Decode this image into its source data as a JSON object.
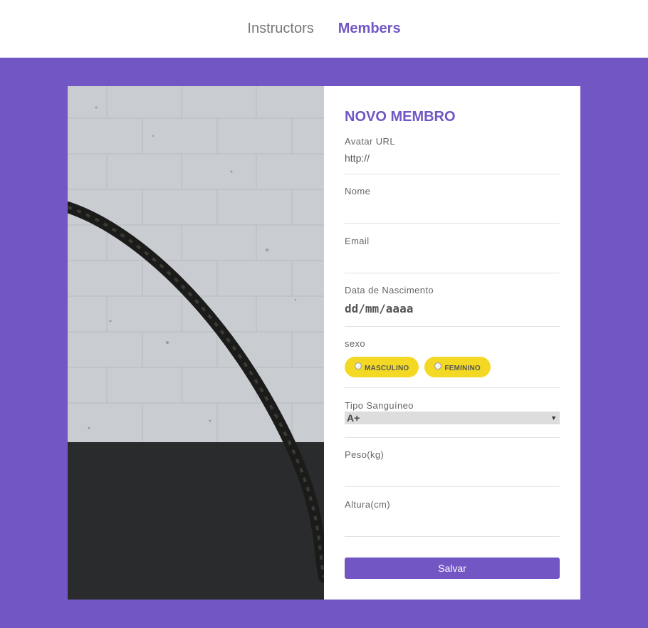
{
  "nav": {
    "items": [
      {
        "label": "Instructors",
        "active": false
      },
      {
        "label": "Members",
        "active": true
      }
    ]
  },
  "form": {
    "title": "NOVO MEMBRO",
    "avatar": {
      "label": "Avatar URL",
      "placeholder": "http://"
    },
    "name": {
      "label": "Nome",
      "placeholder": ""
    },
    "email": {
      "label": "Email",
      "placeholder": ""
    },
    "birth": {
      "label": "Data de Nascimento",
      "value": "dd/mm/aaaa"
    },
    "gender": {
      "label": "sexo",
      "options": [
        "MASCULINO",
        "FEMININO"
      ]
    },
    "blood": {
      "label": "Tipo Sanguíneo",
      "selected": "A+"
    },
    "weight": {
      "label": "Peso(kg)",
      "placeholder": ""
    },
    "height": {
      "label": "Altura(cm)",
      "placeholder": ""
    },
    "save_label": "Salvar"
  },
  "colors": {
    "accent": "#7156c4",
    "pill": "#f4d924"
  },
  "image": {
    "subject": "battle-rope-photo"
  }
}
